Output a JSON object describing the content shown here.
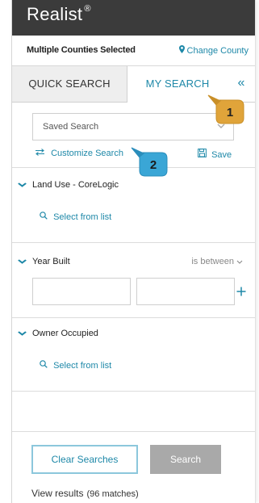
{
  "app": {
    "brand": "Realist",
    "brand_mark": "®"
  },
  "county": {
    "label": "Multiple Counties Selected",
    "change_label": "Change County",
    "icon": "map-pin-icon"
  },
  "tabs": {
    "quick_search": "QUICK SEARCH",
    "my_search": "MY SEARCH",
    "collapse_glyph": "«"
  },
  "saved_search": {
    "placeholder": "Saved Search"
  },
  "actions": {
    "customize_label": "Customize Search",
    "save_label": "Save"
  },
  "filters": {
    "land_use": {
      "title": "Land Use - CoreLogic",
      "select_label": "Select from list"
    },
    "year_built": {
      "title": "Year Built",
      "operator": "is between",
      "from_value": "",
      "to_value": ""
    },
    "owner_occupied": {
      "title": "Owner Occupied",
      "select_label": "Select from list"
    }
  },
  "buttons": {
    "clear": "Clear Searches",
    "search": "Search"
  },
  "results": {
    "label": "View results",
    "matches": "(96 matches)"
  },
  "callouts": [
    {
      "number": "1",
      "color": "#e0a43a"
    },
    {
      "number": "2",
      "color": "#3aa6d6"
    }
  ],
  "colors": {
    "accent": "#1e88a8",
    "topbar": "#3b3b3b"
  }
}
